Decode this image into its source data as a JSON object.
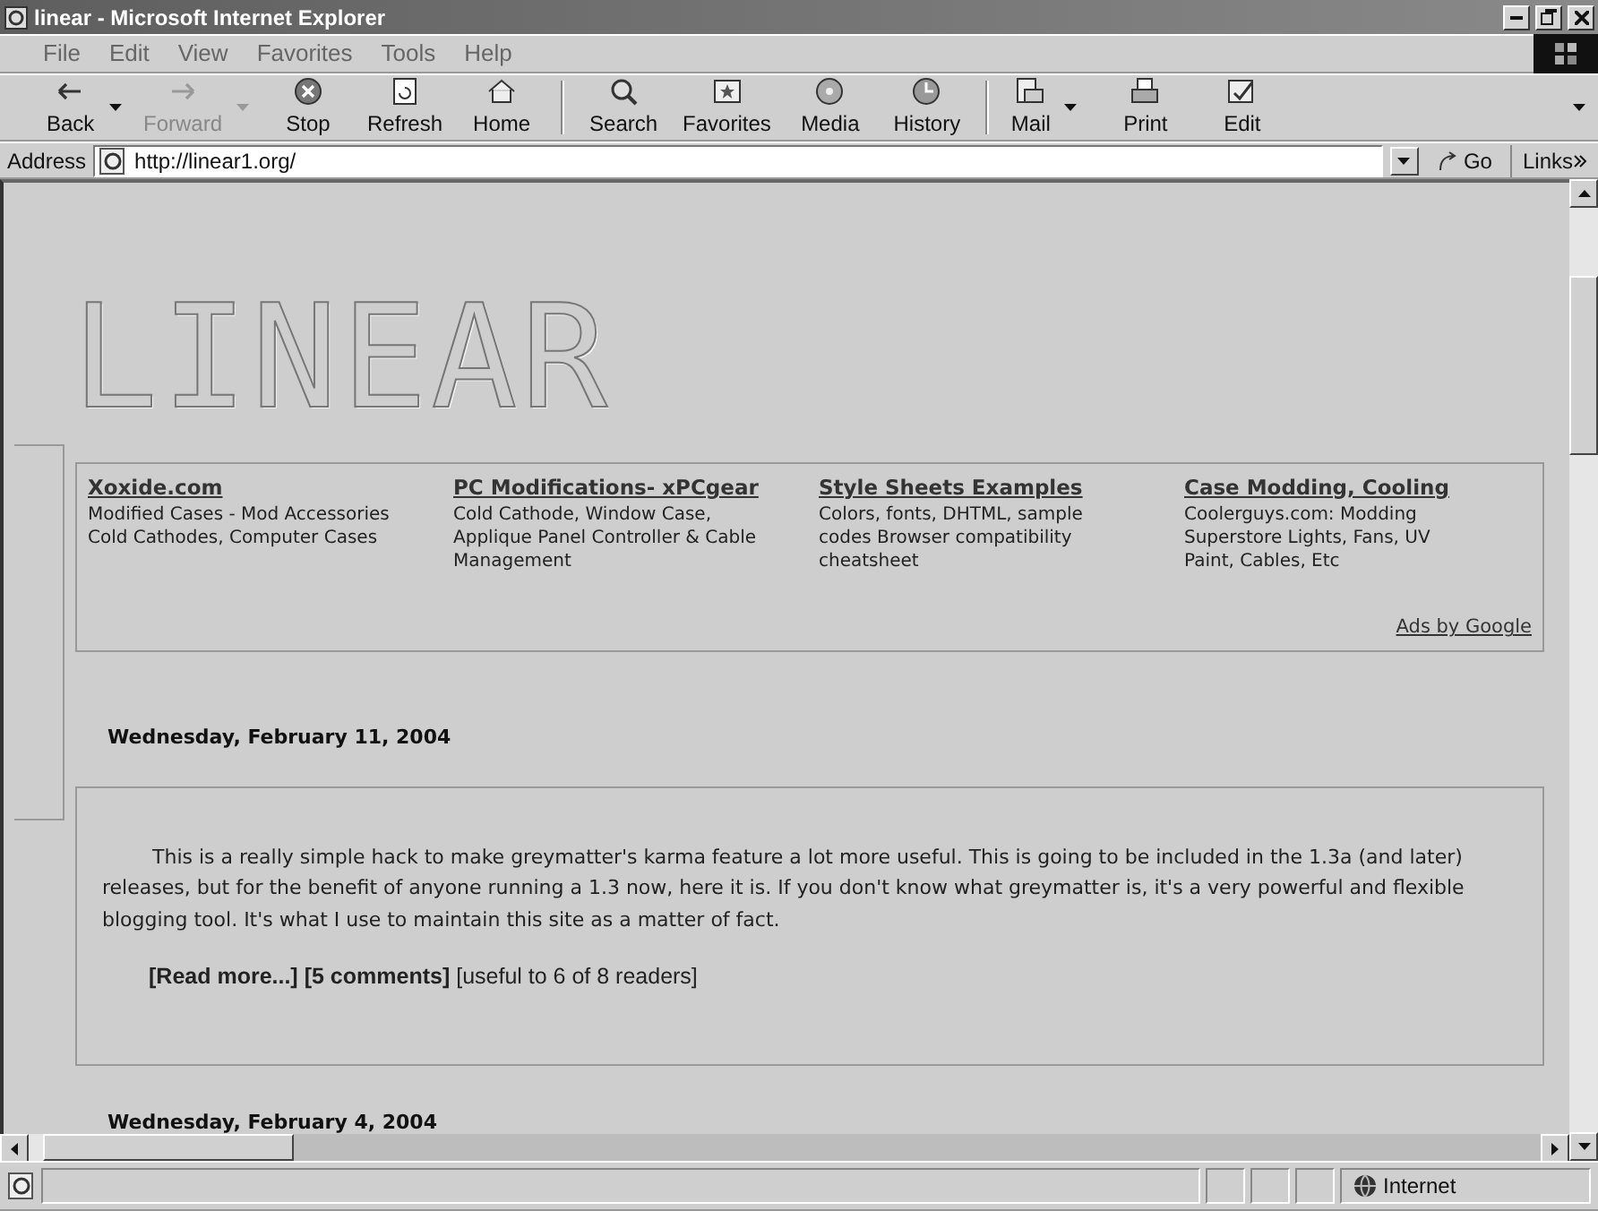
{
  "window": {
    "title": "linear - Microsoft Internet Explorer"
  },
  "menu": [
    "File",
    "Edit",
    "View",
    "Favorites",
    "Tools",
    "Help"
  ],
  "toolbar_groups": [
    [
      {
        "label": "Back",
        "disabled": false,
        "dropdown": true
      },
      {
        "label": "Forward",
        "disabled": true,
        "dropdown": true
      },
      {
        "label": "Stop",
        "disabled": false,
        "dropdown": false
      },
      {
        "label": "Refresh",
        "disabled": false,
        "dropdown": false
      },
      {
        "label": "Home",
        "disabled": false,
        "dropdown": false
      }
    ],
    [
      {
        "label": "Search",
        "disabled": false,
        "dropdown": false
      },
      {
        "label": "Favorites",
        "disabled": false,
        "dropdown": false
      },
      {
        "label": "Media",
        "disabled": false,
        "dropdown": false
      },
      {
        "label": "History",
        "disabled": false,
        "dropdown": false
      }
    ],
    [
      {
        "label": "Mail",
        "disabled": false,
        "dropdown": true
      },
      {
        "label": "Print",
        "disabled": false,
        "dropdown": false
      },
      {
        "label": "Edit",
        "disabled": false,
        "dropdown": false
      }
    ]
  ],
  "address": {
    "label": "Address",
    "value": "http://linear1.org/",
    "go": "Go",
    "links": "Links"
  },
  "page": {
    "logo": "LINEAR",
    "ads": [
      {
        "title": "Xoxide.com",
        "text": "Modified Cases - Mod Accessories Cold Cathodes, Computer Cases"
      },
      {
        "title": "PC Modifications- xPCgear",
        "text": "Cold Cathode, Window Case, Applique Panel Controller & Cable Management"
      },
      {
        "title": "Style Sheets Examples",
        "text": "Colors, fonts, DHTML, sample codes Browser compatibility cheatsheet"
      },
      {
        "title": "Case Modding, Cooling",
        "text": "Coolerguys.com: Modding Superstore Lights, Fans, UV Paint, Cables, Etc"
      }
    ],
    "ads_credit": "Ads by Google",
    "posts": [
      {
        "date": "Wednesday, February 11, 2004",
        "body": "This is a really simple hack to make greymatter's karma feature a lot more useful. This is going to be included in the 1.3a (and later) releases, but for the benefit of anyone running a 1.3 now, here it is. If you don't know what greymatter is, it's a very powerful and flexible blogging tool. It's what I use to maintain this site as a matter of fact.",
        "footer": "**[Read more...]** **[5 comments]** [useful to 6 of 8 readers]"
      }
    ],
    "next_date": "Wednesday, February 4, 2004"
  },
  "status_bar": {
    "zone": "Internet"
  }
}
